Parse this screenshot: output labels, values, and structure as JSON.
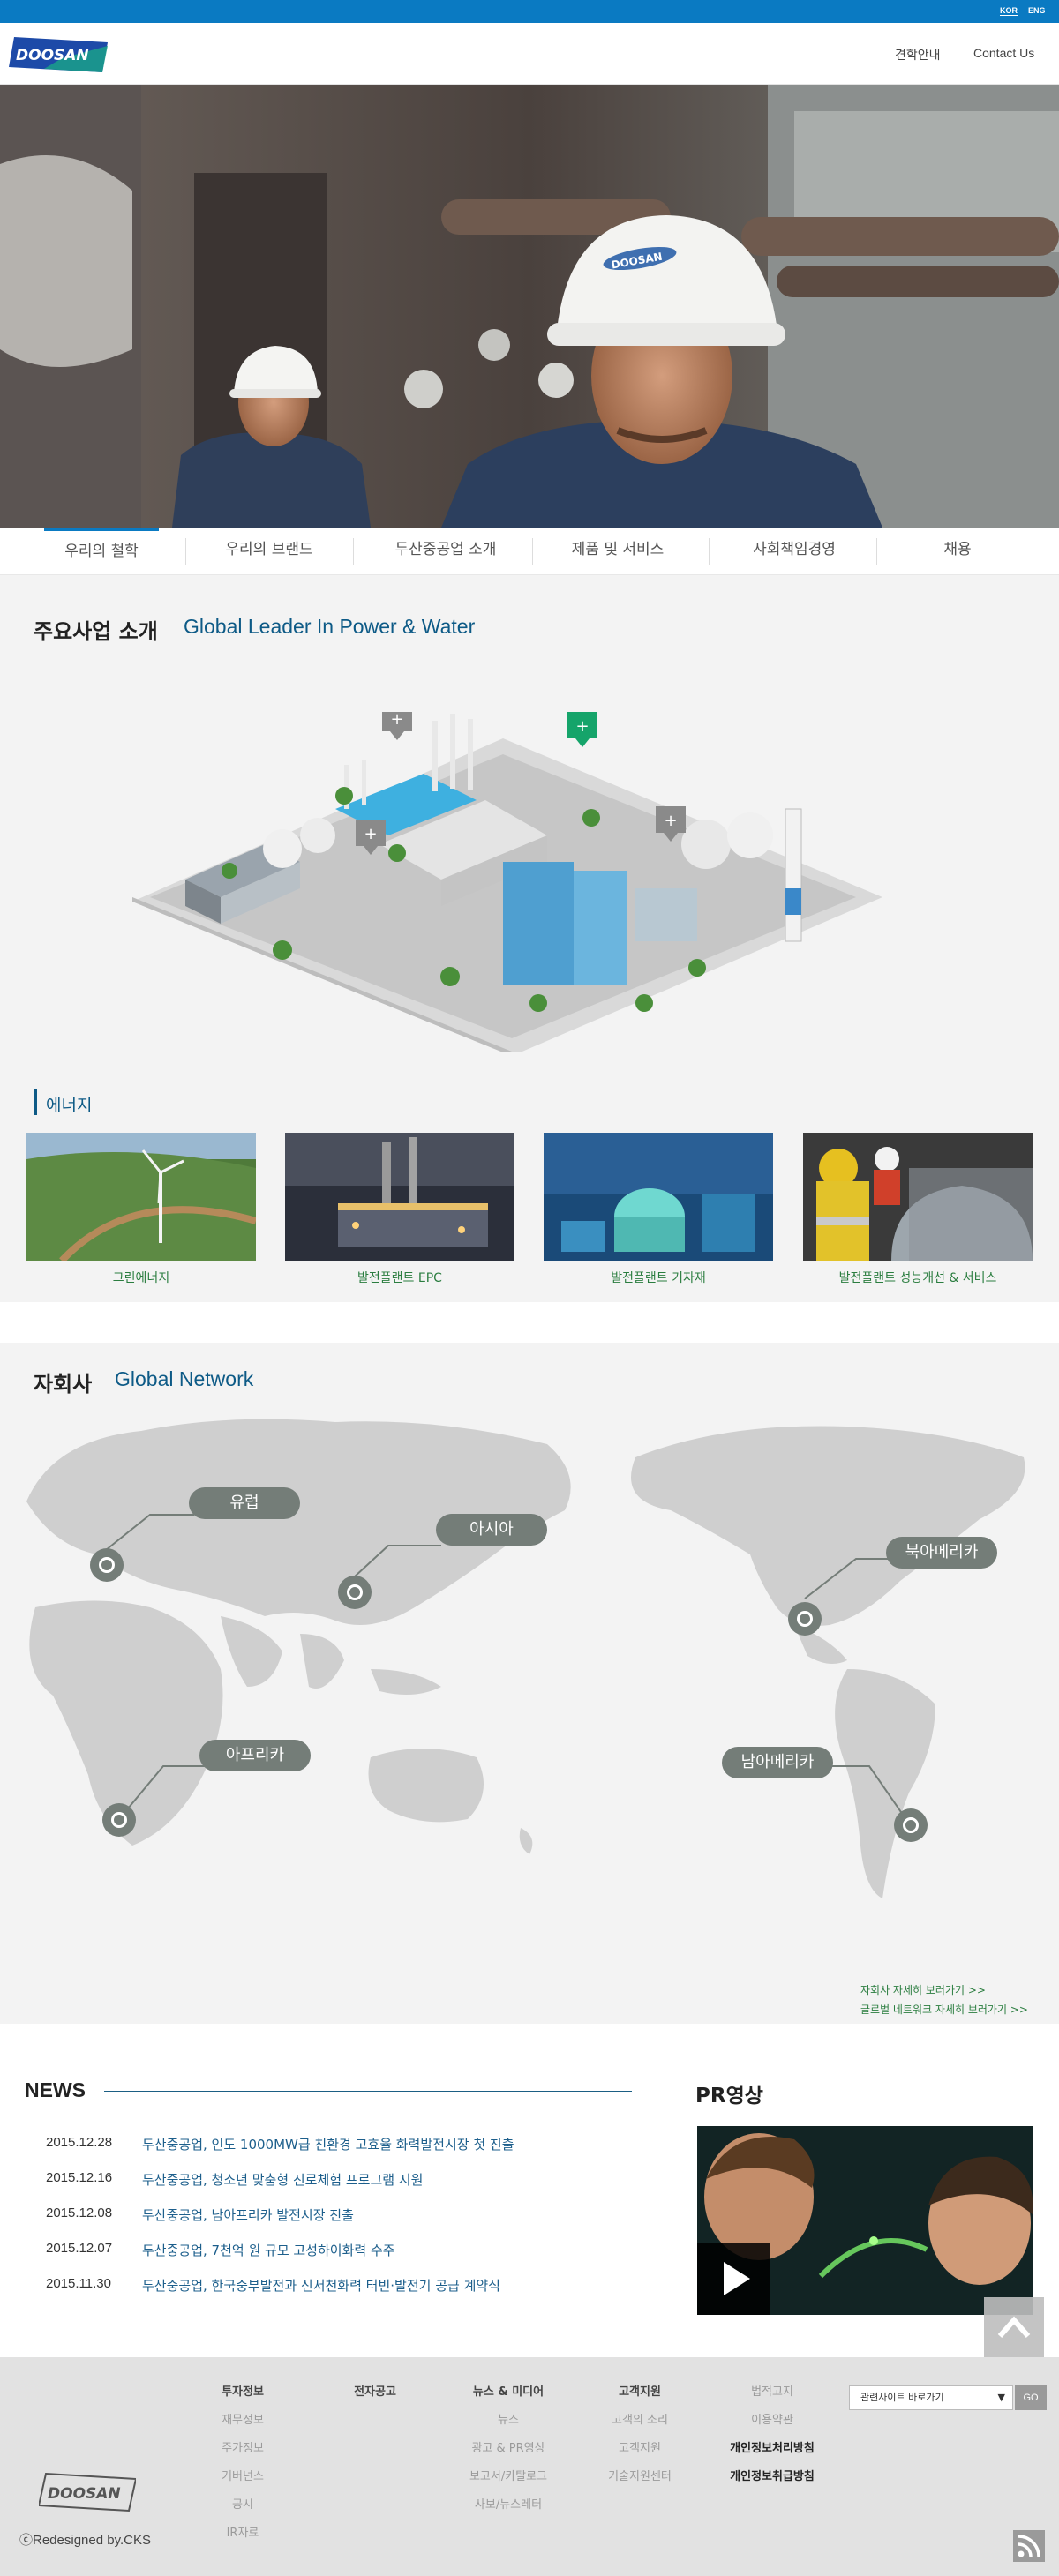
{
  "topbar": {
    "lang_kor": "KOR",
    "lang_eng": "ENG"
  },
  "header": {
    "logo_text": "DOOSAN",
    "link_tour": "견학안내",
    "link_contact": "Contact Us"
  },
  "hero": {
    "helmet_text": "DOOSAN"
  },
  "nav": {
    "items": [
      "우리의 철학",
      "우리의 브랜드",
      "두산중공업 소개",
      "제품 및 서비스",
      "사회책임경영",
      "채용"
    ]
  },
  "business": {
    "title": "주요사업 소개",
    "subtitle": "Global Leader In Power & Water",
    "energy_title": "에너지",
    "thumbs": [
      "그린에너지",
      "발전플랜트 EPC",
      "발전플랜트 기자재",
      "발전플랜트 성능개선 & 서비스"
    ]
  },
  "network": {
    "title": "자회사",
    "subtitle": "Global Network",
    "regions": [
      "유럽",
      "아시아",
      "북아메리카",
      "아프리카",
      "남아메리카"
    ],
    "link_subsidiaries": "자회사 자세히 보러가기 >>",
    "link_global": "글로벌 네트워크 자세히 보러가기 >>"
  },
  "news": {
    "title": "NEWS",
    "items": [
      {
        "date": "2015.12.28",
        "text": "두산중공업, 인도 1000MW급 친환경 고효율 화력발전시장 첫 진출"
      },
      {
        "date": "2015.12.16",
        "text": "두산중공업, 청소년 맞춤형 진로체험 프로그램 지원"
      },
      {
        "date": "2015.12.08",
        "text": "두산중공업, 남아프리카 발전시장 진출"
      },
      {
        "date": "2015.12.07",
        "text": "두산중공업, 7천억 원 규모 고성하이화력 수주"
      },
      {
        "date": "2015.11.30",
        "text": "두산중공업, 한국중부발전과 신서천화력 터빈·발전기 공급 계약식"
      }
    ]
  },
  "pr": {
    "title": "PR영상"
  },
  "footer": {
    "col1": {
      "head": "투자정보",
      "items": [
        "재무정보",
        "주가정보",
        "거버넌스",
        "공시",
        "IR자료"
      ]
    },
    "col2": {
      "head": "전자공고"
    },
    "col3": {
      "head": "뉴스 & 미디어",
      "items": [
        "뉴스",
        "광고 & PR영상",
        "보고서/카탈로그",
        "사보/뉴스레터"
      ]
    },
    "col4": {
      "head": "고객지원",
      "items": [
        "고객의 소리",
        "고객지원",
        "기술지원센터"
      ]
    },
    "col5": {
      "items": [
        "법적고지",
        "이용약관",
        "개인정보처리방침",
        "개인정보취급방침"
      ]
    },
    "select_label": "관련사이트 바로가기",
    "go_label": "GO",
    "logo_text": "DOOSAN",
    "credit": "ⓒRedesigned by.CKS"
  },
  "colors": {
    "brand_blue": "#0a7ac2",
    "title_blue": "#0d5a86",
    "green": "#2a7d3f"
  }
}
